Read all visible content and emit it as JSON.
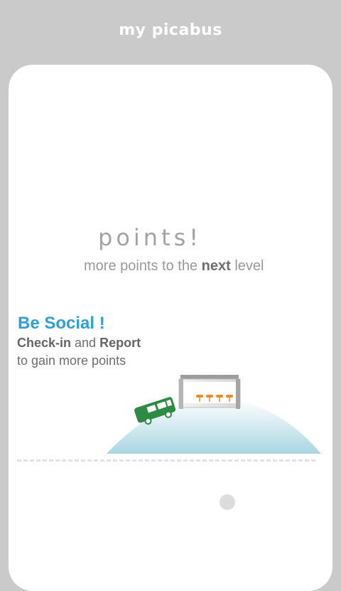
{
  "header": {
    "title": "my picabus"
  },
  "points": {
    "word": "points!",
    "sub_before": "more points to the ",
    "sub_bold": "next",
    "sub_after": " level"
  },
  "social": {
    "title": "Be Social !",
    "checkin": "Check-in",
    "and": " and ",
    "report": "Report",
    "line2": "to gain more points"
  },
  "colors": {
    "background": "#cacaca",
    "card": "#ffffff",
    "accent_blue": "#2f9fd6",
    "bus_green": "#2e8b43",
    "hill": "#b9dfe8",
    "seats_orange": "#f08c1e"
  },
  "pager": {
    "total": 1,
    "active": 0
  }
}
